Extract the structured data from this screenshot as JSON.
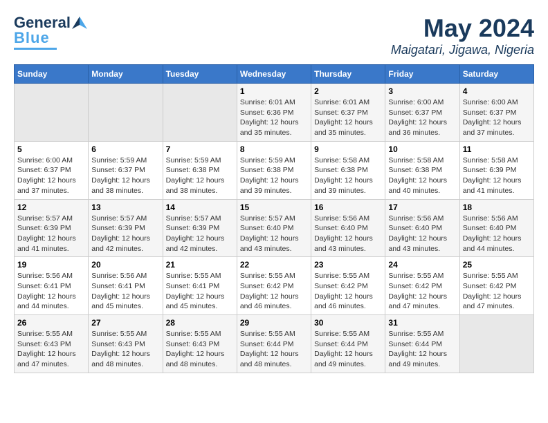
{
  "header": {
    "logo_line1": "General",
    "logo_line2": "Blue",
    "month": "May 2024",
    "location": "Maigatari, Jigawa, Nigeria"
  },
  "calendar": {
    "days_of_week": [
      "Sunday",
      "Monday",
      "Tuesday",
      "Wednesday",
      "Thursday",
      "Friday",
      "Saturday"
    ],
    "weeks": [
      [
        {
          "day": "",
          "info": ""
        },
        {
          "day": "",
          "info": ""
        },
        {
          "day": "",
          "info": ""
        },
        {
          "day": "1",
          "info": "Sunrise: 6:01 AM\nSunset: 6:36 PM\nDaylight: 12 hours\nand 35 minutes."
        },
        {
          "day": "2",
          "info": "Sunrise: 6:01 AM\nSunset: 6:37 PM\nDaylight: 12 hours\nand 35 minutes."
        },
        {
          "day": "3",
          "info": "Sunrise: 6:00 AM\nSunset: 6:37 PM\nDaylight: 12 hours\nand 36 minutes."
        },
        {
          "day": "4",
          "info": "Sunrise: 6:00 AM\nSunset: 6:37 PM\nDaylight: 12 hours\nand 37 minutes."
        }
      ],
      [
        {
          "day": "5",
          "info": "Sunrise: 6:00 AM\nSunset: 6:37 PM\nDaylight: 12 hours\nand 37 minutes."
        },
        {
          "day": "6",
          "info": "Sunrise: 5:59 AM\nSunset: 6:37 PM\nDaylight: 12 hours\nand 38 minutes."
        },
        {
          "day": "7",
          "info": "Sunrise: 5:59 AM\nSunset: 6:38 PM\nDaylight: 12 hours\nand 38 minutes."
        },
        {
          "day": "8",
          "info": "Sunrise: 5:59 AM\nSunset: 6:38 PM\nDaylight: 12 hours\nand 39 minutes."
        },
        {
          "day": "9",
          "info": "Sunrise: 5:58 AM\nSunset: 6:38 PM\nDaylight: 12 hours\nand 39 minutes."
        },
        {
          "day": "10",
          "info": "Sunrise: 5:58 AM\nSunset: 6:38 PM\nDaylight: 12 hours\nand 40 minutes."
        },
        {
          "day": "11",
          "info": "Sunrise: 5:58 AM\nSunset: 6:39 PM\nDaylight: 12 hours\nand 41 minutes."
        }
      ],
      [
        {
          "day": "12",
          "info": "Sunrise: 5:57 AM\nSunset: 6:39 PM\nDaylight: 12 hours\nand 41 minutes."
        },
        {
          "day": "13",
          "info": "Sunrise: 5:57 AM\nSunset: 6:39 PM\nDaylight: 12 hours\nand 42 minutes."
        },
        {
          "day": "14",
          "info": "Sunrise: 5:57 AM\nSunset: 6:39 PM\nDaylight: 12 hours\nand 42 minutes."
        },
        {
          "day": "15",
          "info": "Sunrise: 5:57 AM\nSunset: 6:40 PM\nDaylight: 12 hours\nand 43 minutes."
        },
        {
          "day": "16",
          "info": "Sunrise: 5:56 AM\nSunset: 6:40 PM\nDaylight: 12 hours\nand 43 minutes."
        },
        {
          "day": "17",
          "info": "Sunrise: 5:56 AM\nSunset: 6:40 PM\nDaylight: 12 hours\nand 43 minutes."
        },
        {
          "day": "18",
          "info": "Sunrise: 5:56 AM\nSunset: 6:40 PM\nDaylight: 12 hours\nand 44 minutes."
        }
      ],
      [
        {
          "day": "19",
          "info": "Sunrise: 5:56 AM\nSunset: 6:41 PM\nDaylight: 12 hours\nand 44 minutes."
        },
        {
          "day": "20",
          "info": "Sunrise: 5:56 AM\nSunset: 6:41 PM\nDaylight: 12 hours\nand 45 minutes."
        },
        {
          "day": "21",
          "info": "Sunrise: 5:55 AM\nSunset: 6:41 PM\nDaylight: 12 hours\nand 45 minutes."
        },
        {
          "day": "22",
          "info": "Sunrise: 5:55 AM\nSunset: 6:42 PM\nDaylight: 12 hours\nand 46 minutes."
        },
        {
          "day": "23",
          "info": "Sunrise: 5:55 AM\nSunset: 6:42 PM\nDaylight: 12 hours\nand 46 minutes."
        },
        {
          "day": "24",
          "info": "Sunrise: 5:55 AM\nSunset: 6:42 PM\nDaylight: 12 hours\nand 47 minutes."
        },
        {
          "day": "25",
          "info": "Sunrise: 5:55 AM\nSunset: 6:42 PM\nDaylight: 12 hours\nand 47 minutes."
        }
      ],
      [
        {
          "day": "26",
          "info": "Sunrise: 5:55 AM\nSunset: 6:43 PM\nDaylight: 12 hours\nand 47 minutes."
        },
        {
          "day": "27",
          "info": "Sunrise: 5:55 AM\nSunset: 6:43 PM\nDaylight: 12 hours\nand 48 minutes."
        },
        {
          "day": "28",
          "info": "Sunrise: 5:55 AM\nSunset: 6:43 PM\nDaylight: 12 hours\nand 48 minutes."
        },
        {
          "day": "29",
          "info": "Sunrise: 5:55 AM\nSunset: 6:44 PM\nDaylight: 12 hours\nand 48 minutes."
        },
        {
          "day": "30",
          "info": "Sunrise: 5:55 AM\nSunset: 6:44 PM\nDaylight: 12 hours\nand 49 minutes."
        },
        {
          "day": "31",
          "info": "Sunrise: 5:55 AM\nSunset: 6:44 PM\nDaylight: 12 hours\nand 49 minutes."
        },
        {
          "day": "",
          "info": ""
        }
      ]
    ]
  }
}
